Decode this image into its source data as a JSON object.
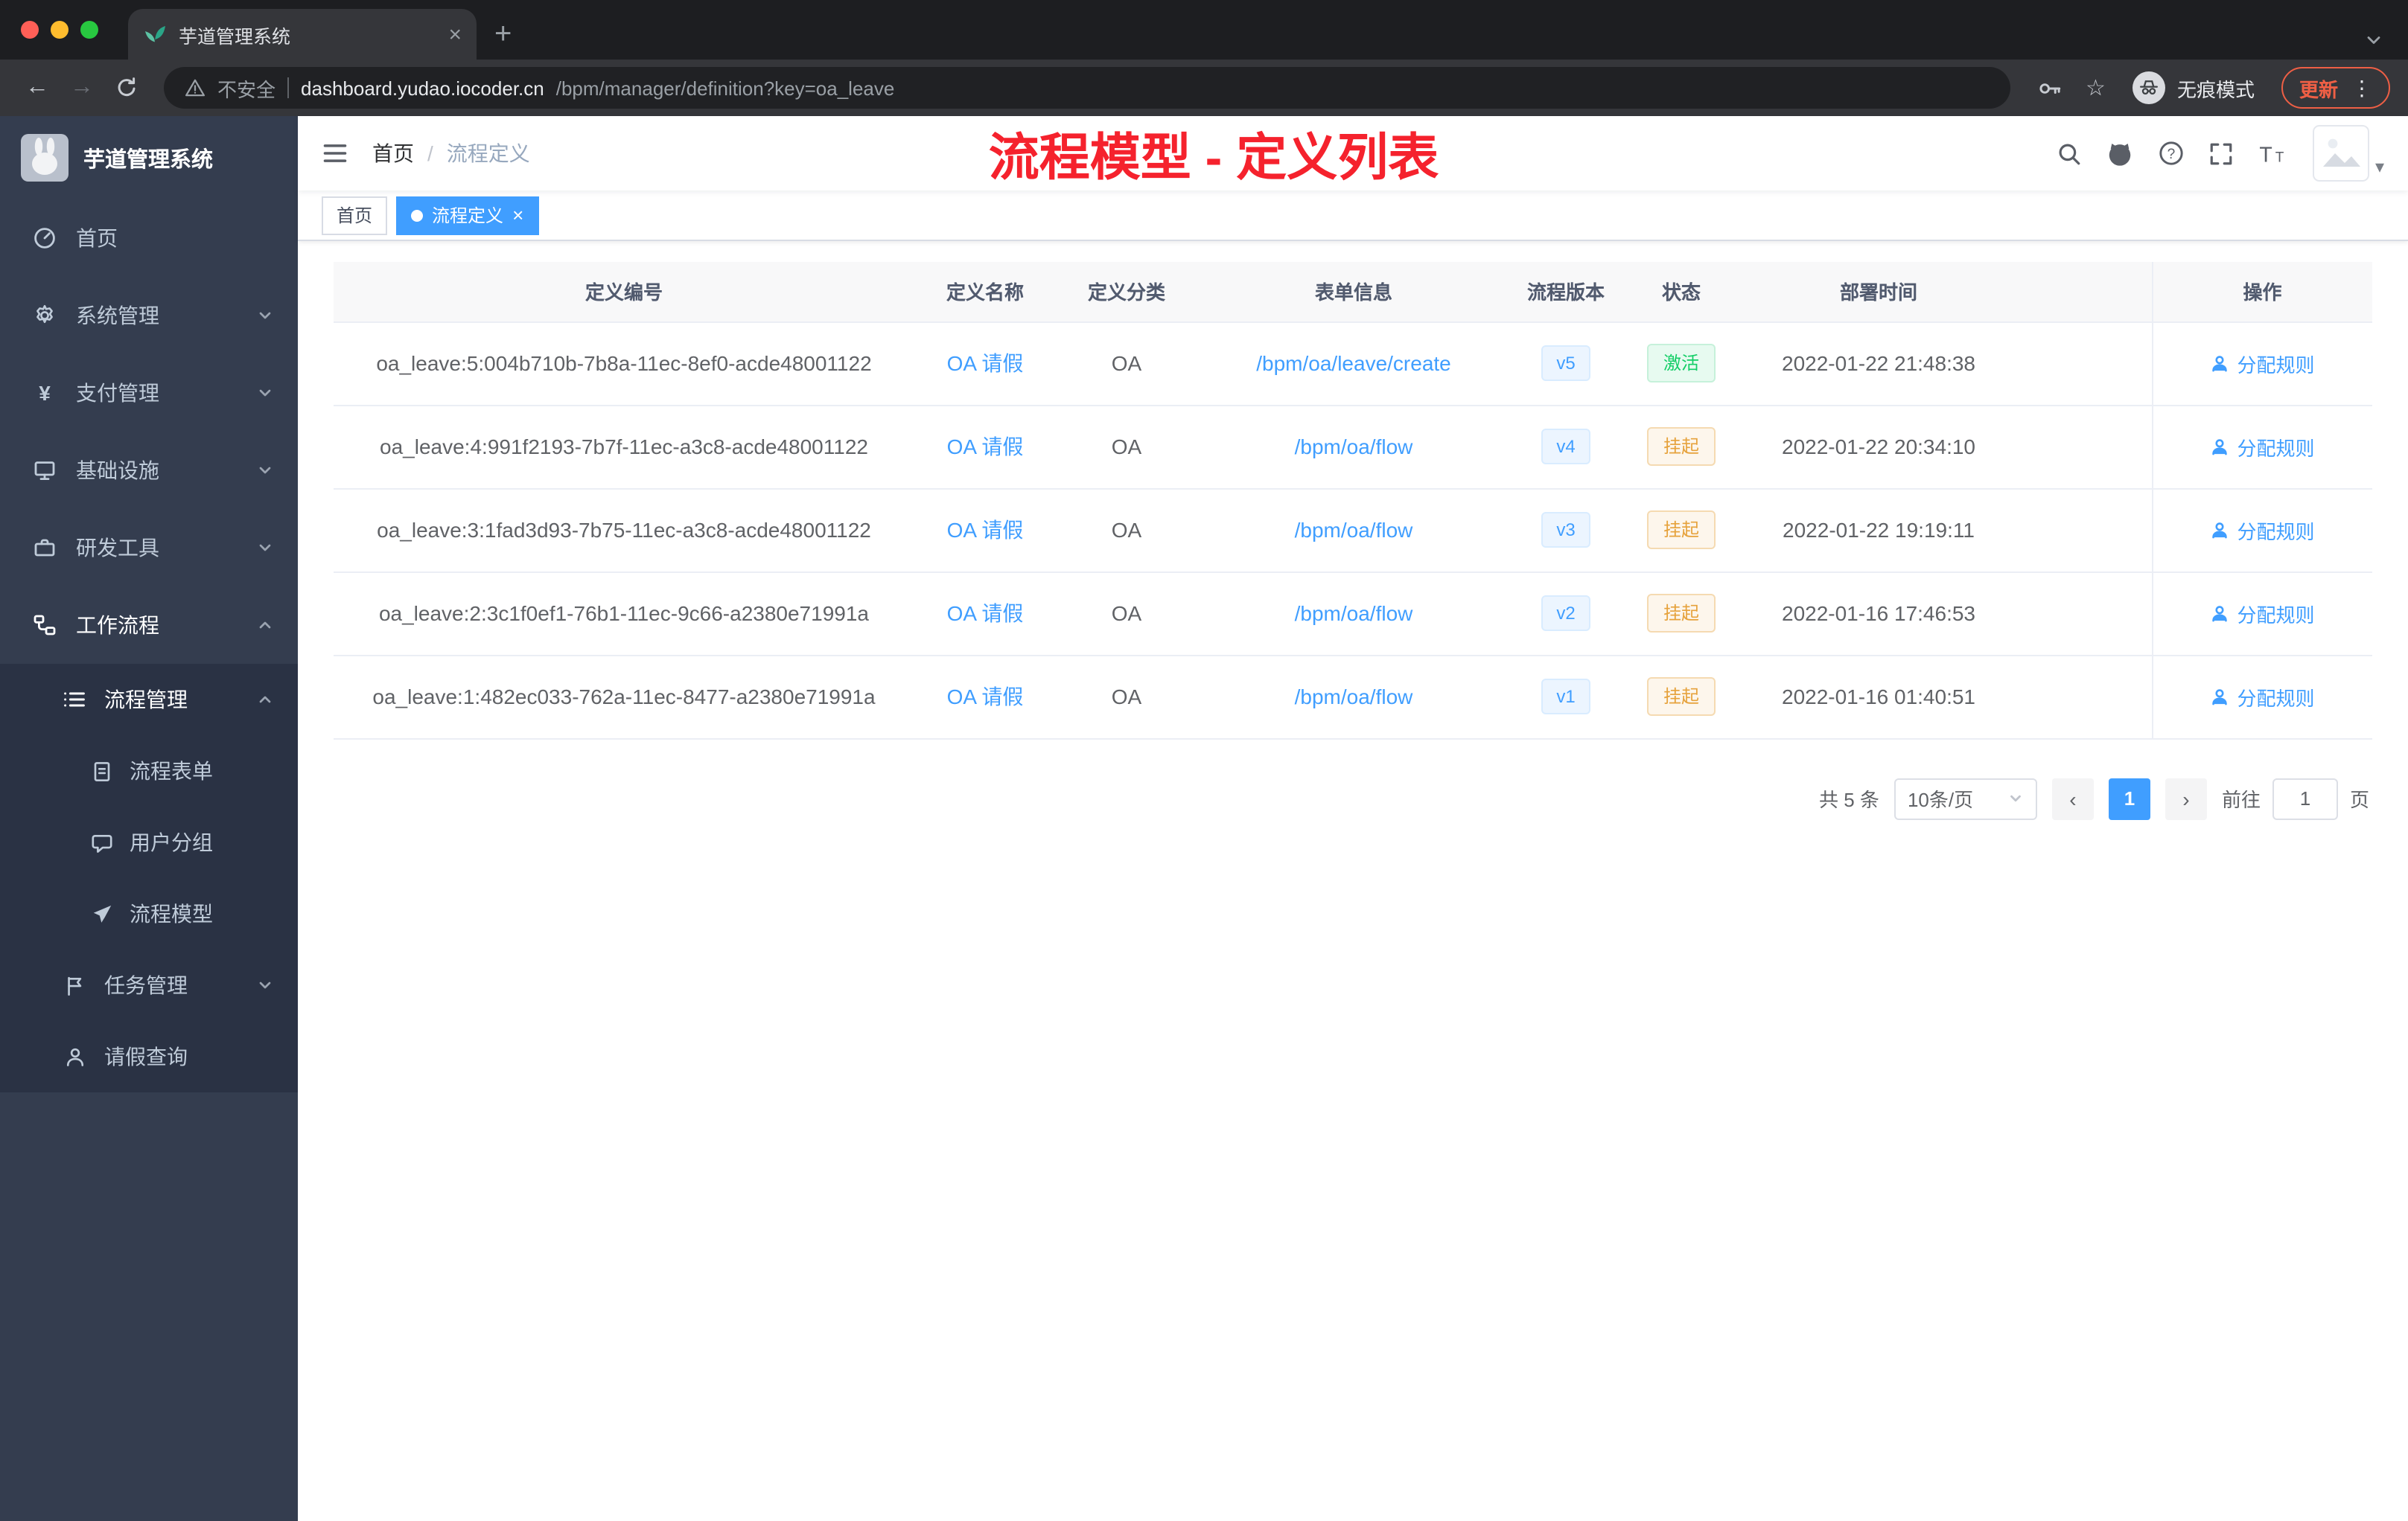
{
  "browser": {
    "tab_title": "芋道管理系统",
    "new_tab_label": "+",
    "security_label": "不安全",
    "url_host": "dashboard.yudao.iocoder.cn",
    "url_path": "/bpm/manager/definition?key=oa_leave",
    "incognito_label": "无痕模式",
    "update_label": "更新"
  },
  "sidebar": {
    "logo_title": "芋道管理系统",
    "items": [
      {
        "label": "首页"
      },
      {
        "label": "系统管理"
      },
      {
        "label": "支付管理"
      },
      {
        "label": "基础设施"
      },
      {
        "label": "研发工具"
      },
      {
        "label": "工作流程"
      }
    ],
    "submenu": {
      "process_group": {
        "label": "流程管理"
      },
      "children": [
        {
          "label": "流程表单"
        },
        {
          "label": "用户分组"
        },
        {
          "label": "流程模型"
        }
      ],
      "task_group": {
        "label": "任务管理"
      },
      "leave_item": {
        "label": "请假查询"
      }
    }
  },
  "header": {
    "breadcrumb_home": "首页",
    "breadcrumb_sep": "/",
    "breadcrumb_current": "流程定义",
    "annotation": "流程模型 - 定义列表"
  },
  "tags": {
    "home": "首页",
    "current": "流程定义",
    "close": "×"
  },
  "table": {
    "columns": {
      "id": "定义编号",
      "name": "定义名称",
      "category": "定义分类",
      "form": "表单信息",
      "version": "流程版本",
      "status": "状态",
      "deploy_time": "部署时间",
      "action": "操作"
    },
    "action_label": "分配规则",
    "rows": [
      {
        "id": "oa_leave:5:004b710b-7b8a-11ec-8ef0-acde48001122",
        "name": "OA 请假",
        "category": "OA",
        "form": "/bpm/oa/leave/create",
        "version": "v5",
        "status": "激活",
        "deploy_time": "2022-01-22 21:48:38"
      },
      {
        "id": "oa_leave:4:991f2193-7b7f-11ec-a3c8-acde48001122",
        "name": "OA 请假",
        "category": "OA",
        "form": "/bpm/oa/flow",
        "version": "v4",
        "status": "挂起",
        "deploy_time": "2022-01-22 20:34:10"
      },
      {
        "id": "oa_leave:3:1fad3d93-7b75-11ec-a3c8-acde48001122",
        "name": "OA 请假",
        "category": "OA",
        "form": "/bpm/oa/flow",
        "version": "v3",
        "status": "挂起",
        "deploy_time": "2022-01-22 19:19:11"
      },
      {
        "id": "oa_leave:2:3c1f0ef1-76b1-11ec-9c66-a2380e71991a",
        "name": "OA 请假",
        "category": "OA",
        "form": "/bpm/oa/flow",
        "version": "v2",
        "status": "挂起",
        "deploy_time": "2022-01-16 17:46:53"
      },
      {
        "id": "oa_leave:1:482ec033-762a-11ec-8477-a2380e71991a",
        "name": "OA 请假",
        "category": "OA",
        "form": "/bpm/oa/flow",
        "version": "v1",
        "status": "挂起",
        "deploy_time": "2022-01-16 01:40:51"
      }
    ]
  },
  "pagination": {
    "total": "共 5 条",
    "page_size": "10条/页",
    "prev": "‹",
    "next": "›",
    "current_page": "1",
    "goto_prefix": "前往",
    "goto_value": "1",
    "goto_suffix": "页"
  }
}
